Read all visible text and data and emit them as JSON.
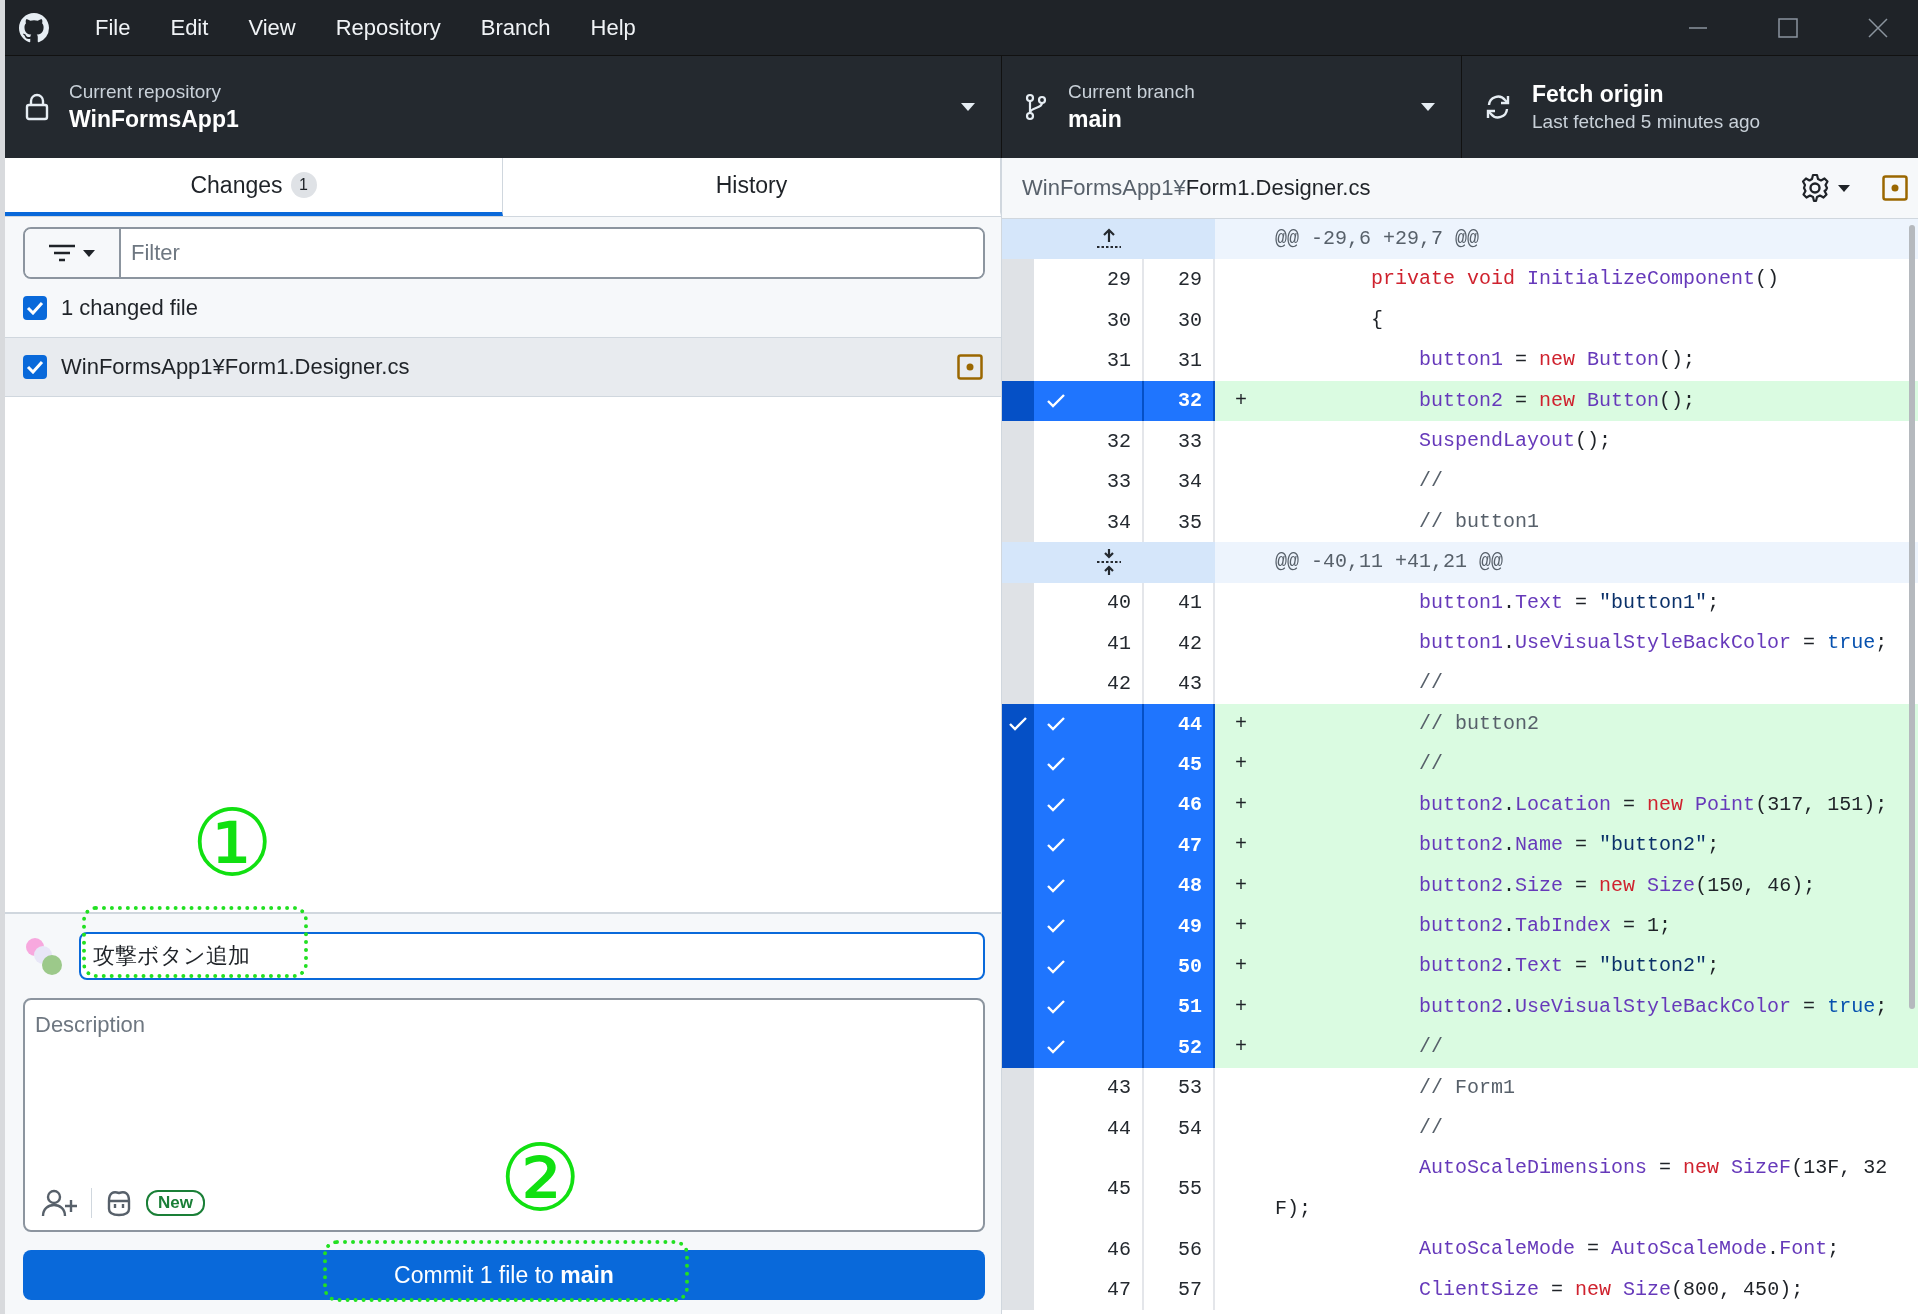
{
  "menu": [
    "File",
    "Edit",
    "View",
    "Repository",
    "Branch",
    "Help"
  ],
  "toolbar": {
    "repository": {
      "label": "Current repository",
      "value": "WinFormsApp1"
    },
    "branch": {
      "label": "Current branch",
      "value": "main"
    },
    "fetch": {
      "title": "Fetch origin",
      "subtitle": "Last fetched 5 minutes ago"
    }
  },
  "tabs": [
    {
      "label": "Changes",
      "count": "1",
      "selected": true
    },
    {
      "label": "History",
      "selected": false
    }
  ],
  "filter": {
    "placeholder": "Filter"
  },
  "changes_header": {
    "label": "1 changed file",
    "checked": true
  },
  "files": [
    {
      "path": "WinFormsApp1¥Form1.Designer.cs",
      "checked": true,
      "selected": true
    }
  ],
  "commit": {
    "summary": "攻撃ボタン追加",
    "description_placeholder": "Description",
    "badge": "New",
    "button": "Commit 1 file to **main**"
  },
  "diff": {
    "directory": "WinFormsApp1¥",
    "filename": "Form1.Designer.cs",
    "lines": [
      {
        "kind": "hunk_start",
        "text": "@@ -29,6 +29,7 @@"
      },
      {
        "kind": "context",
        "old": "29",
        "new": "29",
        "code": [
          {
            "kind": "keyword",
            "text": "        private"
          },
          {
            "kind": "keyword",
            "text": " void"
          },
          {
            "kind": "identifier",
            "text": " InitializeComponent"
          },
          {
            "kind": "plain",
            "text": "()"
          }
        ]
      },
      {
        "kind": "context",
        "old": "30",
        "new": "30",
        "code": [
          {
            "kind": "plain",
            "text": "        {"
          }
        ]
      },
      {
        "kind": "context",
        "old": "31",
        "new": "31",
        "code": [
          {
            "kind": "identifier",
            "text": "            button1"
          },
          {
            "kind": "plain",
            "text": " = "
          },
          {
            "kind": "keyword",
            "text": "new"
          },
          {
            "kind": "identifier",
            "text": " Button"
          },
          {
            "kind": "plain",
            "text": "();"
          }
        ]
      },
      {
        "kind": "added",
        "marker": "+",
        "new": "32",
        "selected": true,
        "strip_check": false,
        "code": [
          {
            "kind": "identifier",
            "text": "            button2"
          },
          {
            "kind": "plain",
            "text": " = "
          },
          {
            "kind": "keyword",
            "text": "new"
          },
          {
            "kind": "identifier",
            "text": " Button"
          },
          {
            "kind": "plain",
            "text": "();"
          }
        ]
      },
      {
        "kind": "context",
        "old": "32",
        "new": "33",
        "code": [
          {
            "kind": "identifier",
            "text": "            SuspendLayout"
          },
          {
            "kind": "plain",
            "text": "();"
          }
        ]
      },
      {
        "kind": "context",
        "old": "33",
        "new": "34",
        "code": [
          {
            "kind": "comment",
            "text": "            //"
          }
        ]
      },
      {
        "kind": "context",
        "old": "34",
        "new": "35",
        "code": [
          {
            "kind": "comment",
            "text": "            // button1"
          }
        ]
      },
      {
        "kind": "hunk",
        "text": "@@ -40,11 +41,21 @@"
      },
      {
        "kind": "context",
        "old": "40",
        "new": "41",
        "code": [
          {
            "kind": "identifier",
            "text": "            button1"
          },
          {
            "kind": "plain",
            "text": "."
          },
          {
            "kind": "identifier",
            "text": "Text"
          },
          {
            "kind": "plain",
            "text": " = "
          },
          {
            "kind": "string",
            "text": "\"button1\""
          },
          {
            "kind": "plain",
            "text": ";"
          }
        ]
      },
      {
        "kind": "context",
        "old": "41",
        "new": "42",
        "code": [
          {
            "kind": "identifier",
            "text": "            button1"
          },
          {
            "kind": "plain",
            "text": "."
          },
          {
            "kind": "identifier",
            "text": "UseVisualStyleBackColor"
          },
          {
            "kind": "plain",
            "text": " = "
          },
          {
            "kind": "literal",
            "text": "true"
          },
          {
            "kind": "plain",
            "text": ";"
          }
        ]
      },
      {
        "kind": "context",
        "old": "42",
        "new": "43",
        "code": [
          {
            "kind": "comment",
            "text": "            //"
          }
        ]
      },
      {
        "kind": "added",
        "marker": "+",
        "new": "44",
        "selected": true,
        "strip_check": true,
        "code": [
          {
            "kind": "comment",
            "text": "            // button2"
          }
        ]
      },
      {
        "kind": "added",
        "marker": "+",
        "new": "45",
        "selected": true,
        "strip_check": false,
        "code": [
          {
            "kind": "comment",
            "text": "            //"
          }
        ]
      },
      {
        "kind": "added",
        "marker": "+",
        "new": "46",
        "selected": true,
        "strip_check": false,
        "code": [
          {
            "kind": "identifier",
            "text": "            button2"
          },
          {
            "kind": "plain",
            "text": "."
          },
          {
            "kind": "identifier",
            "text": "Location"
          },
          {
            "kind": "plain",
            "text": " = "
          },
          {
            "kind": "keyword",
            "text": "new"
          },
          {
            "kind": "identifier",
            "text": " Point"
          },
          {
            "kind": "plain",
            "text": "(317, 151);"
          }
        ]
      },
      {
        "kind": "added",
        "marker": "+",
        "new": "47",
        "selected": true,
        "strip_check": false,
        "code": [
          {
            "kind": "identifier",
            "text": "            button2"
          },
          {
            "kind": "plain",
            "text": "."
          },
          {
            "kind": "identifier",
            "text": "Name"
          },
          {
            "kind": "plain",
            "text": " = "
          },
          {
            "kind": "string",
            "text": "\"button2\""
          },
          {
            "kind": "plain",
            "text": ";"
          }
        ]
      },
      {
        "kind": "added",
        "marker": "+",
        "new": "48",
        "selected": true,
        "strip_check": false,
        "code": [
          {
            "kind": "identifier",
            "text": "            button2"
          },
          {
            "kind": "plain",
            "text": "."
          },
          {
            "kind": "identifier",
            "text": "Size"
          },
          {
            "kind": "plain",
            "text": " = "
          },
          {
            "kind": "keyword",
            "text": "new"
          },
          {
            "kind": "identifier",
            "text": " Size"
          },
          {
            "kind": "plain",
            "text": "(150, 46);"
          }
        ]
      },
      {
        "kind": "added",
        "marker": "+",
        "new": "49",
        "selected": true,
        "strip_check": false,
        "code": [
          {
            "kind": "identifier",
            "text": "            button2"
          },
          {
            "kind": "plain",
            "text": "."
          },
          {
            "kind": "identifier",
            "text": "TabIndex"
          },
          {
            "kind": "plain",
            "text": " = 1;"
          }
        ]
      },
      {
        "kind": "added",
        "marker": "+",
        "new": "50",
        "selected": true,
        "strip_check": false,
        "code": [
          {
            "kind": "identifier",
            "text": "            button2"
          },
          {
            "kind": "plain",
            "text": "."
          },
          {
            "kind": "identifier",
            "text": "Text"
          },
          {
            "kind": "plain",
            "text": " = "
          },
          {
            "kind": "string",
            "text": "\"button2\""
          },
          {
            "kind": "plain",
            "text": ";"
          }
        ]
      },
      {
        "kind": "added",
        "marker": "+",
        "new": "51",
        "selected": true,
        "strip_check": false,
        "code": [
          {
            "kind": "identifier",
            "text": "            button2"
          },
          {
            "kind": "plain",
            "text": "."
          },
          {
            "kind": "identifier",
            "text": "UseVisualStyleBackColor"
          },
          {
            "kind": "plain",
            "text": " = "
          },
          {
            "kind": "literal",
            "text": "true"
          },
          {
            "kind": "plain",
            "text": ";"
          }
        ]
      },
      {
        "kind": "added",
        "marker": "+",
        "new": "52",
        "selected": true,
        "strip_check": false,
        "code": [
          {
            "kind": "comment",
            "text": "            //"
          }
        ]
      },
      {
        "kind": "context",
        "old": "43",
        "new": "53",
        "code": [
          {
            "kind": "comment",
            "text": "            // Form1"
          }
        ]
      },
      {
        "kind": "context",
        "old": "44",
        "new": "54",
        "code": [
          {
            "kind": "comment",
            "text": "            //"
          }
        ]
      },
      {
        "kind": "context",
        "old": "45",
        "new": "55",
        "code": [
          {
            "kind": "identifier",
            "text": "            AutoScaleDimensions"
          },
          {
            "kind": "plain",
            "text": " = "
          },
          {
            "kind": "keyword",
            "text": "new"
          },
          {
            "kind": "identifier",
            "text": " SizeF"
          },
          {
            "kind": "plain",
            "text": "(13F, 32F);"
          }
        ]
      },
      {
        "kind": "context",
        "old": "46",
        "new": "56",
        "code": [
          {
            "kind": "identifier",
            "text": "            AutoScaleMode"
          },
          {
            "kind": "plain",
            "text": " = "
          },
          {
            "kind": "identifier",
            "text": "AutoScaleMode"
          },
          {
            "kind": "plain",
            "text": "."
          },
          {
            "kind": "identifier",
            "text": "Font"
          },
          {
            "kind": "plain",
            "text": ";"
          }
        ]
      },
      {
        "kind": "context",
        "old": "47",
        "new": "57",
        "code": [
          {
            "kind": "identifier",
            "text": "            ClientSize"
          },
          {
            "kind": "plain",
            "text": " = "
          },
          {
            "kind": "keyword",
            "text": "new"
          },
          {
            "kind": "identifier",
            "text": " Size"
          },
          {
            "kind": "plain",
            "text": "(800, 450);"
          }
        ]
      }
    ]
  },
  "annotations": {
    "summary_field": {
      "number": "①"
    },
    "commit_button": {
      "number": "②"
    }
  }
}
